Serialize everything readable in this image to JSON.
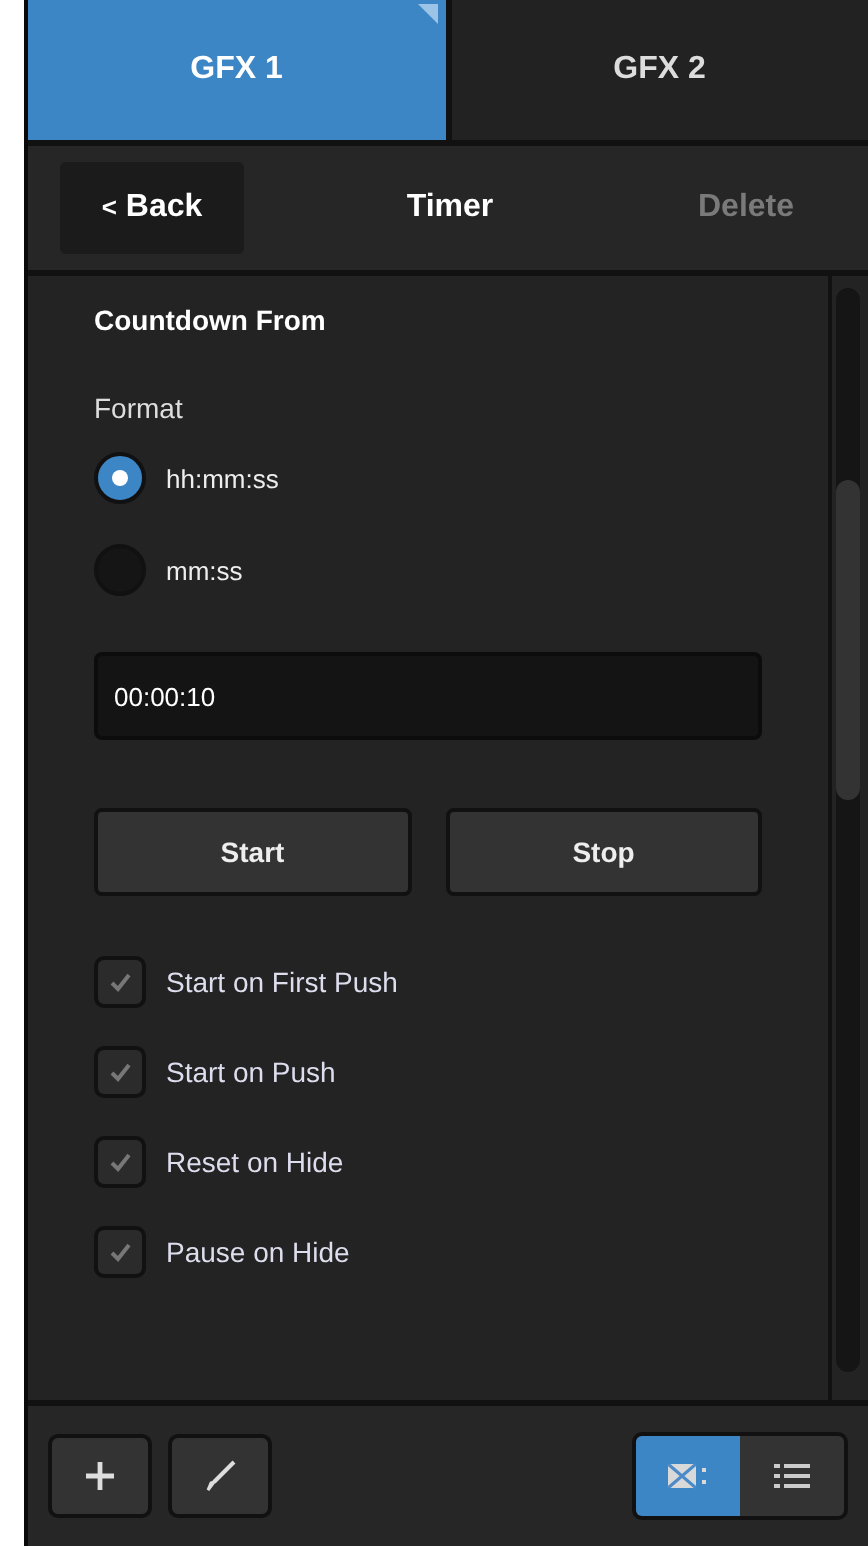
{
  "tabs": [
    {
      "label": "GFX 1",
      "selected": true
    },
    {
      "label": "GFX 2",
      "selected": false
    }
  ],
  "header": {
    "back": "Back",
    "back_glyph": "<",
    "title": "Timer",
    "delete": "Delete",
    "delete_disabled": true
  },
  "section_title": "Countdown From",
  "format": {
    "label": "Format",
    "options": [
      {
        "label": "hh:mm:ss",
        "selected": true
      },
      {
        "label": "mm:ss",
        "selected": false
      }
    ]
  },
  "time_field": {
    "value": "00:00:10"
  },
  "buttons": [
    "Start",
    "Stop"
  ],
  "checkbox_groups": [
    [
      {
        "label": "Start on First Push",
        "checked": true
      },
      {
        "label": "Start on Push",
        "checked": true
      }
    ],
    [
      {
        "label": "Reset on Hide",
        "checked": true
      },
      {
        "label": "Pause on Hide",
        "checked": true
      }
    ]
  ],
  "view_toggle": [
    {
      "kind": "grid",
      "selected": true
    },
    {
      "kind": "list",
      "selected": false
    }
  ]
}
